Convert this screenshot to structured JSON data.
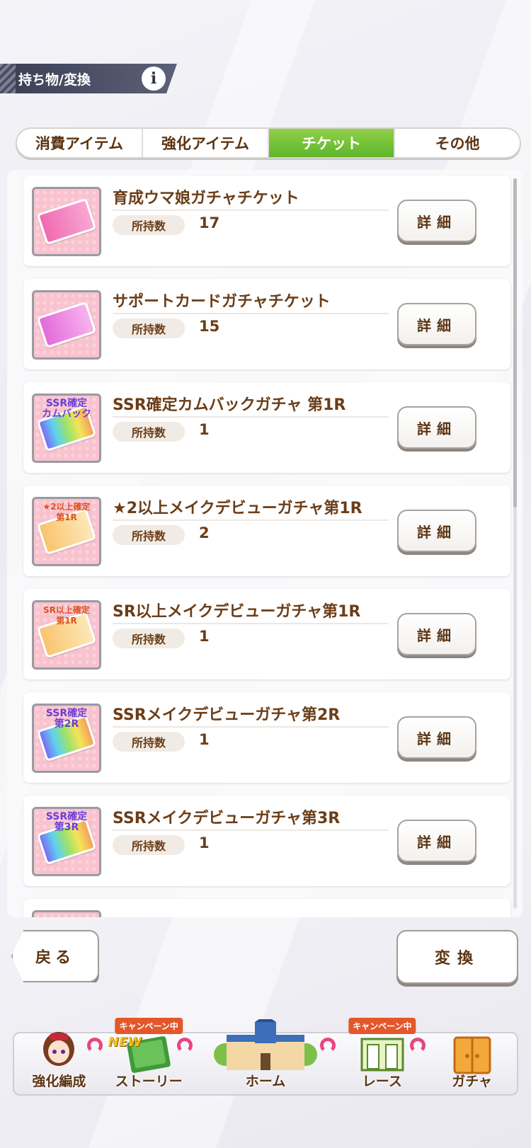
{
  "header": {
    "title": "持ち物/変換",
    "info_icon": "i"
  },
  "tabs": [
    {
      "label": "消費アイテム",
      "active": false
    },
    {
      "label": "強化アイテム",
      "active": false
    },
    {
      "label": "チケット",
      "active": true
    },
    {
      "label": "その他",
      "active": false
    }
  ],
  "items": [
    {
      "name": "育成ウマ娘ガチャチケット",
      "count_label": "所持数",
      "count": "17",
      "detail_label": "詳細",
      "icon": "character-gacha-ticket-icon",
      "ticket_label": ""
    },
    {
      "name": "サポートカードガチャチケット",
      "count_label": "所持数",
      "count": "15",
      "detail_label": "詳細",
      "icon": "support-card-gacha-ticket-icon",
      "ticket_label": ""
    },
    {
      "name": "SSR確定カムバックガチャ 第1R",
      "count_label": "所持数",
      "count": "1",
      "detail_label": "詳細",
      "icon": "ssr-comeback-ticket-icon",
      "ticket_label": "SSR確定\nカムバック"
    },
    {
      "name": "★2以上メイクデビューガチャ第1R",
      "count_label": "所持数",
      "count": "2",
      "detail_label": "詳細",
      "icon": "star2-debut-ticket-icon",
      "ticket_label": "★2以上確定\n第1R"
    },
    {
      "name": "SR以上メイクデビューガチャ第1R",
      "count_label": "所持数",
      "count": "1",
      "detail_label": "詳細",
      "icon": "sr-debut-ticket-icon",
      "ticket_label": "SR以上確定\n第1R"
    },
    {
      "name": "SSRメイクデビューガチャ第2R",
      "count_label": "所持数",
      "count": "1",
      "detail_label": "詳細",
      "icon": "ssr-debut-2r-ticket-icon",
      "ticket_label": "SSR確定\n第2R"
    },
    {
      "name": "SSRメイクデビューガチャ第3R",
      "count_label": "所持数",
      "count": "1",
      "detail_label": "詳細",
      "icon": "ssr-debut-3r-ticket-icon",
      "ticket_label": "SSR確定\n第3R"
    }
  ],
  "buttons": {
    "back": "戻る",
    "convert": "変換"
  },
  "nav": [
    {
      "label": "強化編成",
      "badge": "",
      "new": ""
    },
    {
      "label": "ストーリー",
      "badge": "キャンペーン中",
      "new": "NEW"
    },
    {
      "label": "ホーム",
      "badge": "",
      "new": ""
    },
    {
      "label": "レース",
      "badge": "キャンペーン中",
      "new": ""
    },
    {
      "label": "ガチャ",
      "badge": "",
      "new": ""
    }
  ],
  "colors": {
    "accent": "#5fb52a",
    "text": "#6b3d17",
    "header": "#3b3f55"
  }
}
